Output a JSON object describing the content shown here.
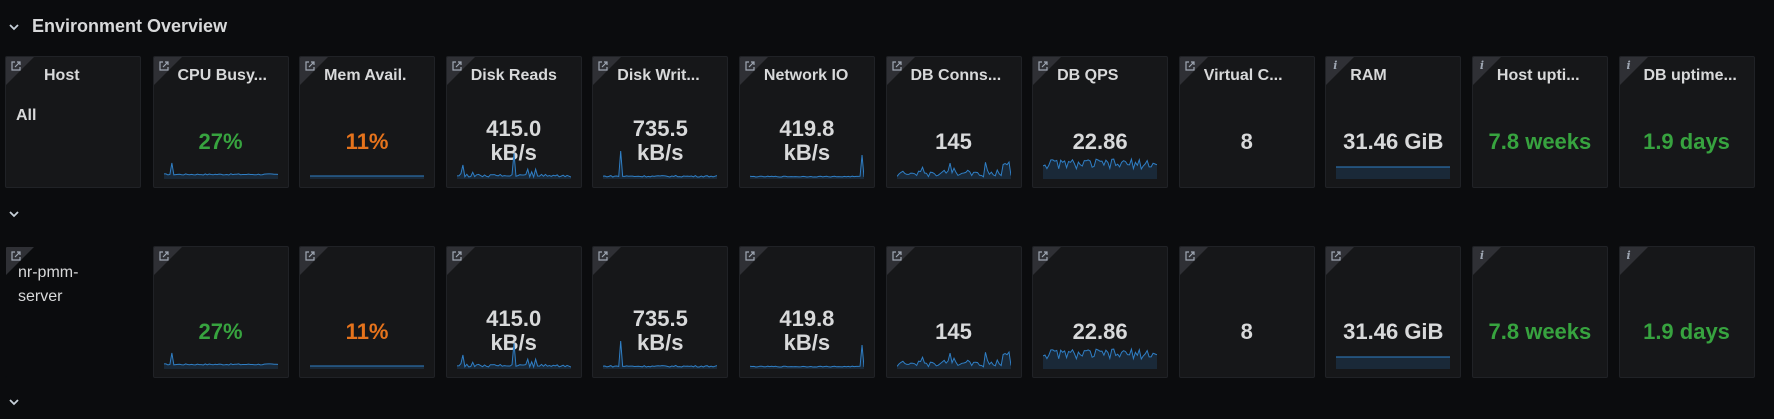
{
  "row_title": "Environment Overview",
  "colors": {
    "green": "#37a33f",
    "orange": "#e5731c",
    "blue": "#2f7fc6",
    "panel_bg": "#161719"
  },
  "host_panel": {
    "title": "Host",
    "value": "All"
  },
  "panels": [
    {
      "title": "CPU Busy...",
      "value": "27%",
      "color": "green",
      "icon": "external-link-icon"
    },
    {
      "title": "Mem Avail.",
      "value": "11%",
      "color": "orange",
      "icon": "external-link-icon"
    },
    {
      "title": "Disk Reads",
      "value_line1": "415.0",
      "value_line2": "kB/s",
      "color": "white",
      "icon": "external-link-icon"
    },
    {
      "title": "Disk Writ...",
      "value_line1": "735.5",
      "value_line2": "kB/s",
      "color": "white",
      "icon": "external-link-icon"
    },
    {
      "title": "Network IO",
      "value_line1": "419.8",
      "value_line2": "kB/s",
      "color": "white",
      "icon": "external-link-icon"
    },
    {
      "title": "DB Conns...",
      "value": "145",
      "color": "white",
      "icon": "external-link-icon"
    },
    {
      "title": "DB QPS",
      "value": "22.86",
      "color": "white",
      "icon": "external-link-icon"
    },
    {
      "title": "Virtual C...",
      "value": "8",
      "color": "white",
      "icon": "external-link-icon"
    },
    {
      "title": "RAM",
      "value": "31.46 GiB",
      "color": "white",
      "icon": "info-icon"
    },
    {
      "title": "Host upti...",
      "value": "7.8 weeks",
      "color": "green",
      "icon": "info-icon"
    },
    {
      "title": "DB uptime...",
      "value": "1.9 days",
      "color": "green",
      "icon": "info-icon"
    }
  ],
  "row2_host": {
    "value_line1": "nr-pmm-",
    "value_line2": "server"
  },
  "row2_panels": [
    {
      "value": "27%",
      "color": "green",
      "icon": "external-link-icon"
    },
    {
      "value": "11%",
      "color": "orange",
      "icon": "external-link-icon"
    },
    {
      "value_line1": "415.0",
      "value_line2": "kB/s",
      "color": "white",
      "icon": "external-link-icon"
    },
    {
      "value_line1": "735.5",
      "value_line2": "kB/s",
      "color": "white",
      "icon": "external-link-icon"
    },
    {
      "value_line1": "419.8",
      "value_line2": "kB/s",
      "color": "white",
      "icon": "external-link-icon"
    },
    {
      "value": "145",
      "color": "white",
      "icon": "external-link-icon"
    },
    {
      "value": "22.86",
      "color": "white",
      "icon": "external-link-icon"
    },
    {
      "value": "8",
      "color": "white",
      "icon": "external-link-icon"
    },
    {
      "value": "31.46 GiB",
      "color": "white",
      "icon": "external-link-icon"
    },
    {
      "value": "7.8 weeks",
      "color": "green",
      "icon": "info-icon"
    },
    {
      "value": "1.9 days",
      "color": "green",
      "icon": "info-icon"
    }
  ]
}
